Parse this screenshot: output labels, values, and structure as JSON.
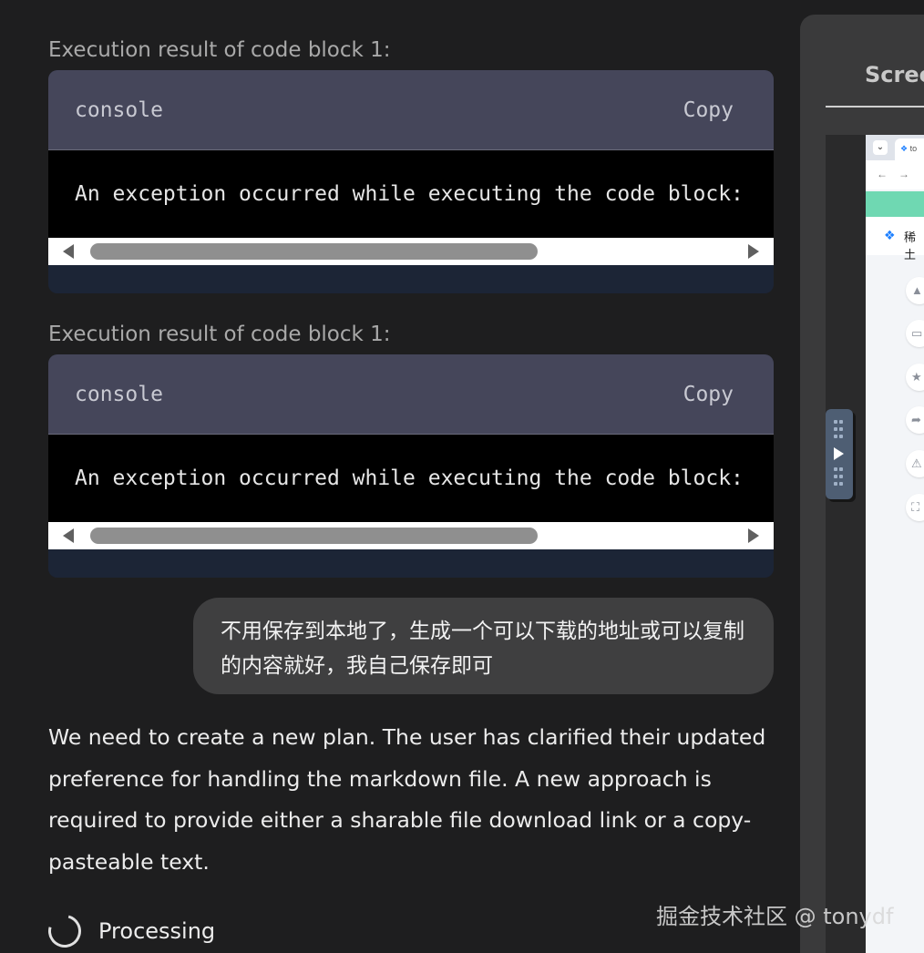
{
  "code_blocks": [
    {
      "label": "Execution result of code block 1:",
      "language": "console",
      "copy_label": "Copy",
      "output": "An exception occurred while executing the code block:"
    },
    {
      "label": "Execution result of code block 1:",
      "language": "console",
      "copy_label": "Copy",
      "output": "An exception occurred while executing the code block:"
    }
  ],
  "user_message": "不用保存到本地了，生成一个可以下载的地址或可以复制的内容就好，我自己保存即可",
  "assistant_message": "We need to create a new plan. The user has clarified their updated preference for handling the markdown file. A new approach is required to provide either a sharable file download link or a copy-pasteable text.",
  "status": {
    "processing_label": "Processing"
  },
  "watermark": "掘金技术社区 @ tonydf",
  "side_panel": {
    "title": "Scree",
    "browser_tab": "to",
    "brand_text": "稀土",
    "icons": [
      "thumb-up-icon",
      "comment-icon",
      "star-icon",
      "share-icon",
      "warning-icon",
      "fullscreen-icon"
    ]
  }
}
